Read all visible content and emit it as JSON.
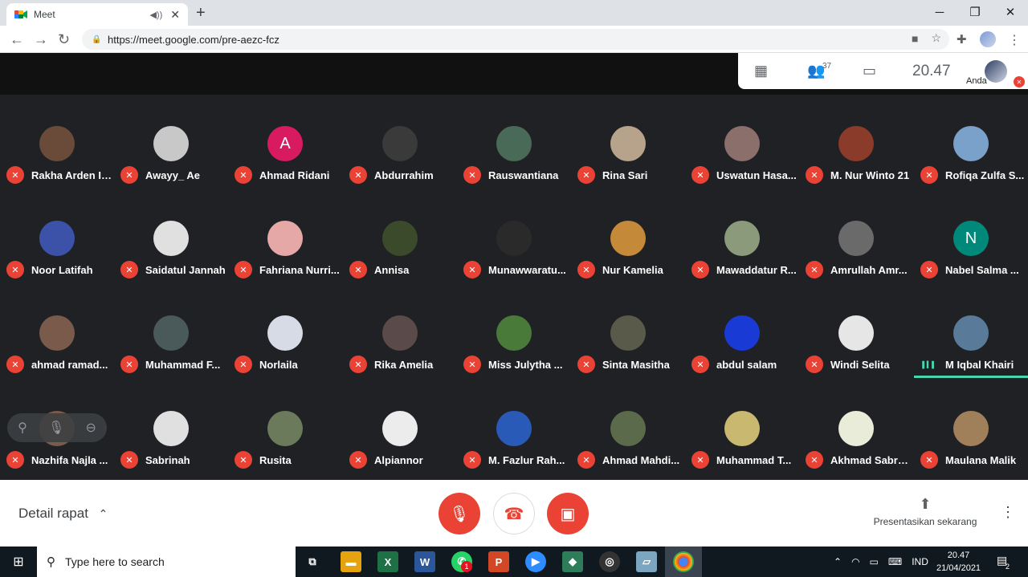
{
  "browser": {
    "tab_title": "Meet",
    "new_tab": "+",
    "audio_icon": "speaker-icon",
    "url": "https://meet.google.com/pre-aezc-fcz",
    "window_min": "─",
    "window_restore": "❐",
    "window_close": "✕",
    "back": "←",
    "forward": "→",
    "reload": "↻"
  },
  "meet_header": {
    "participant_count": "37",
    "clock": "20.47",
    "self_label": "Anda"
  },
  "participants": [
    {
      "name": "Rakha Arden Ir...",
      "avatar": "photo",
      "color": "#6a4b3a"
    },
    {
      "name": "Awayy_ Ae",
      "avatar": "photo",
      "color": "#c8c8c8"
    },
    {
      "name": "Ahmad Ridani",
      "avatar": "letter",
      "letter": "A",
      "color": "#d81b60"
    },
    {
      "name": "Abdurrahim",
      "avatar": "photo",
      "color": "#3a3a3a"
    },
    {
      "name": "Rauswantiana",
      "avatar": "photo",
      "color": "#4a6a58"
    },
    {
      "name": "Rina Sari",
      "avatar": "photo",
      "color": "#b7a38c"
    },
    {
      "name": "Uswatun Hasa...",
      "avatar": "photo",
      "color": "#8a6f6a"
    },
    {
      "name": "M. Nur Winto 21",
      "avatar": "photo",
      "color": "#8b3b2a"
    },
    {
      "name": "Rofiqa Zulfa S...",
      "avatar": "photo",
      "color": "#7aa1c9"
    },
    {
      "name": "Noor Latifah",
      "avatar": "photo",
      "color": "#3c52a8"
    },
    {
      "name": "Saidatul Jannah",
      "avatar": "photo",
      "color": "#e0e0e0"
    },
    {
      "name": "Fahriana Nurri...",
      "avatar": "photo",
      "color": "#e6a7a7"
    },
    {
      "name": "Annisa",
      "avatar": "photo",
      "color": "#3a4a2a"
    },
    {
      "name": "Munawwaratu...",
      "avatar": "photo",
      "color": "#2a2a2a"
    },
    {
      "name": "Nur Kamelia",
      "avatar": "photo",
      "color": "#c48a3a"
    },
    {
      "name": "Mawaddatur R...",
      "avatar": "photo",
      "color": "#8a9a7a"
    },
    {
      "name": "Amrullah Amr...",
      "avatar": "photo",
      "color": "#6a6a6a"
    },
    {
      "name": "Nabel Salma ...",
      "avatar": "letter",
      "letter": "N",
      "color": "#00897b"
    },
    {
      "name": "ahmad ramad...",
      "avatar": "photo",
      "color": "#7a5a4a"
    },
    {
      "name": "Muhammad F...",
      "avatar": "photo",
      "color": "#4a5a5a"
    },
    {
      "name": "Norlaila",
      "avatar": "photo",
      "color": "#d6dbe6"
    },
    {
      "name": "Rika Amelia",
      "avatar": "photo",
      "color": "#5a4a4a"
    },
    {
      "name": "Miss Julytha ...",
      "avatar": "photo",
      "color": "#4a7a3a"
    },
    {
      "name": "Sinta Masitha",
      "avatar": "photo",
      "color": "#5a5a4a"
    },
    {
      "name": "abdul salam",
      "avatar": "photo",
      "color": "#1a3ad6"
    },
    {
      "name": "Windi Selita",
      "avatar": "photo",
      "color": "#e6e6e6"
    },
    {
      "name": "M Iqbal Khairi",
      "avatar": "photo",
      "color": "#5a7a9a"
    },
    {
      "name": "Nazhifa Najla ...",
      "avatar": "photo",
      "color": "#7a5a4a"
    },
    {
      "name": "Sabrinah",
      "avatar": "photo",
      "color": "#e0e0e0"
    },
    {
      "name": "Rusita",
      "avatar": "photo",
      "color": "#6a7a5a"
    },
    {
      "name": "Alpiannor",
      "avatar": "photo",
      "color": "#ececec"
    },
    {
      "name": "M. Fazlur Rah...",
      "avatar": "photo",
      "color": "#2a5ab8"
    },
    {
      "name": "Ahmad Mahdi...",
      "avatar": "photo",
      "color": "#5a6a4a"
    },
    {
      "name": "Muhammad T...",
      "avatar": "photo",
      "color": "#c8b870"
    },
    {
      "name": "Akhmad Sabry...",
      "avatar": "photo",
      "color": "#e8ecd8"
    },
    {
      "name": "Maulana Malik",
      "avatar": "photo",
      "color": "#a0805a"
    }
  ],
  "bottom": {
    "detail_label": "Detail rapat",
    "present_label": "Presentasikan sekarang"
  },
  "taskbar": {
    "search_placeholder": "Type here to search",
    "lang": "IND",
    "time": "20.47",
    "date": "21/04/2021",
    "whatsapp_badge": "1",
    "notification_count": "2"
  },
  "colors": {
    "mic_off": "#ea4335",
    "speaking": "#48d6b0",
    "grid_bg": "#202124"
  }
}
